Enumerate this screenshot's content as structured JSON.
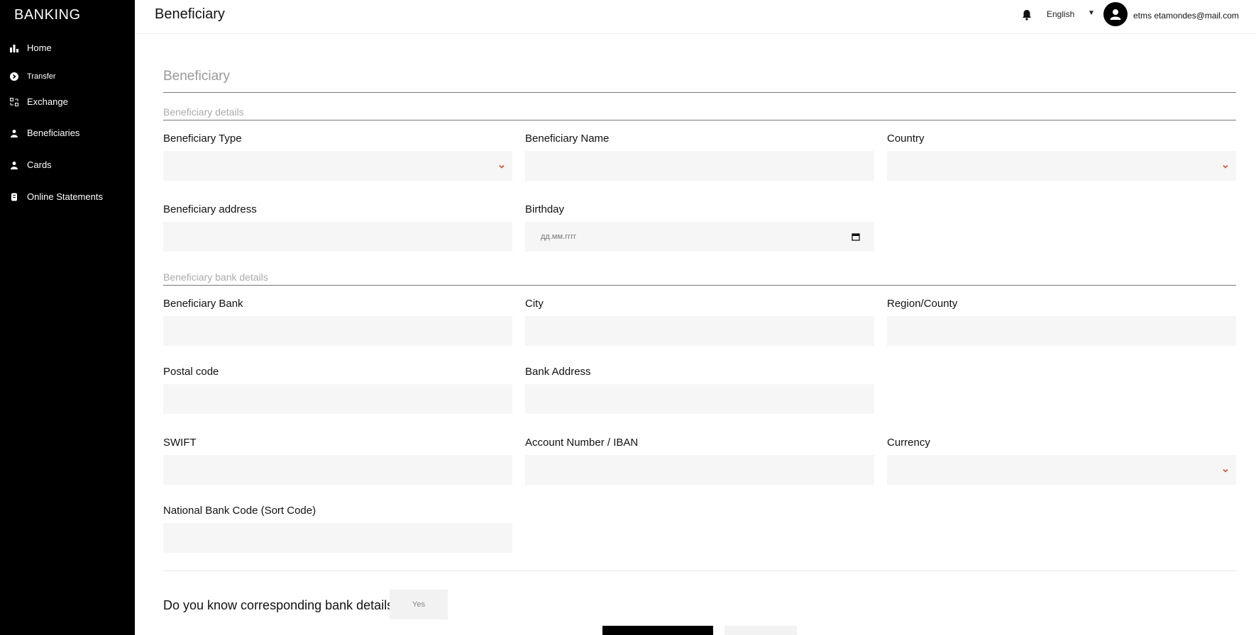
{
  "app": {
    "logo": "BANKING"
  },
  "sidebar": {
    "items": [
      {
        "label": "Home",
        "icon": "bar-chart-icon"
      },
      {
        "label": "Transfer",
        "icon": "transfer-icon"
      },
      {
        "label": "Exchange",
        "icon": "exchange-icon"
      },
      {
        "label": "Beneficiaries",
        "icon": "users-icon"
      },
      {
        "label": "Cards",
        "icon": "cards-icon"
      },
      {
        "label": "Online Statements",
        "icon": "statements-icon"
      }
    ]
  },
  "header": {
    "title": "Beneficiary",
    "language": "English",
    "user_email": "etms etamondes@mail.com"
  },
  "form": {
    "title": "Beneficiary",
    "details_section": "Beneficiary details",
    "bank_section": "Beneficiary bank details",
    "labels": {
      "beneficiary_type": "Beneficiary Type",
      "beneficiary_name": "Beneficiary Name",
      "country": "Country",
      "beneficiary_address": "Beneficiary address",
      "birthday": "Birthday",
      "beneficiary_bank": "Beneficiary Bank",
      "city": "City",
      "region": "Region/County",
      "postal_code": "Postal code",
      "bank_address": "Bank Address",
      "swift": "SWIFT",
      "account_number": "Account Number / IBAN",
      "currency": "Currency",
      "national_bank_code": "National Bank Code (Sort Code)"
    },
    "birthday_placeholder": "дд.мм.гггг",
    "corresponding_question": "Do you know corresponding bank details?",
    "yes_label": "Yes"
  },
  "colors": {
    "sidebar_bg": "#000000",
    "accent": "#e0502a",
    "field_bg": "#f6f6f6"
  }
}
